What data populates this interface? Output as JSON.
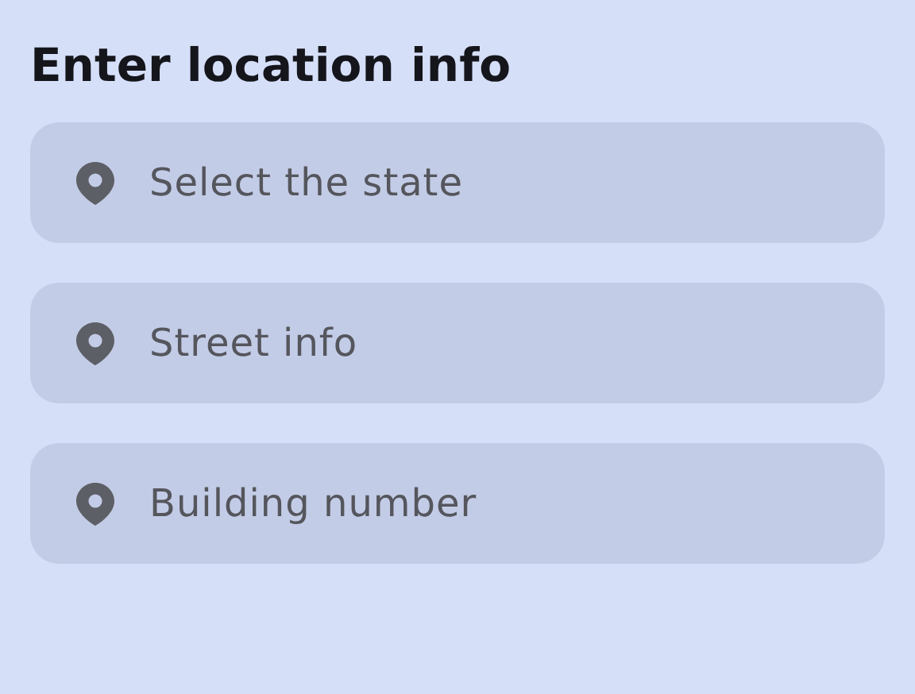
{
  "title": "Enter location info",
  "fields": [
    {
      "placeholder": "Select the state"
    },
    {
      "placeholder": "Street info"
    },
    {
      "placeholder": "Building number"
    }
  ]
}
